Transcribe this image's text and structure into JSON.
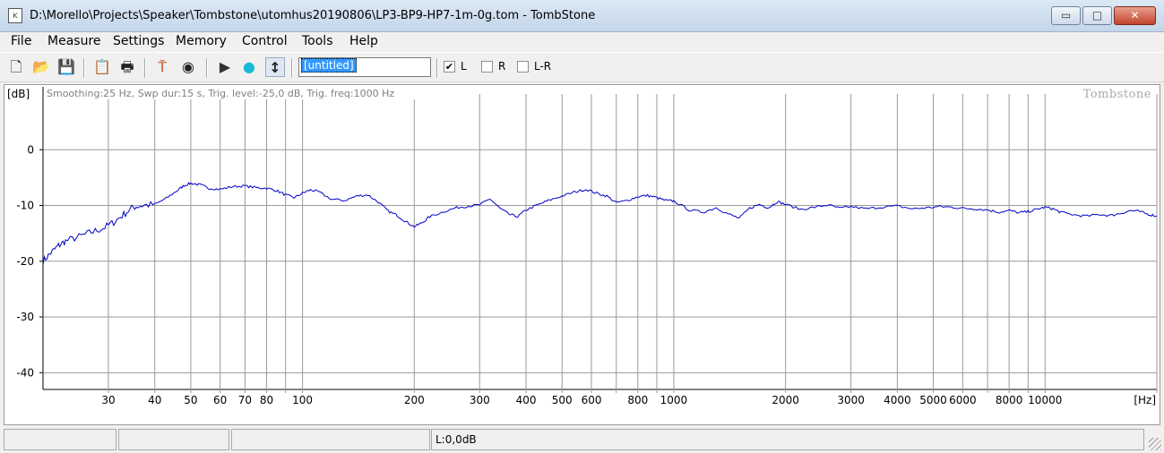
{
  "window": {
    "title": "D:\\Morello\\Projects\\Speaker\\Tombstone\\utomhus20190806\\LP3-BP9-HP7-1m-0g.tom - TombStone",
    "app_icon": "tombstone-app-icon",
    "minimize_glyph": "▭",
    "maximize_glyph": "□",
    "close_glyph": "✕"
  },
  "menu": {
    "items": [
      "File",
      "Measure",
      "Settings",
      "Memory",
      "Control",
      "Tools",
      "Help"
    ]
  },
  "toolbar": {
    "icons": [
      "new-icon",
      "open-icon",
      "save-icon",
      "copy-icon",
      "print-icon",
      "probe-icon",
      "speaker-icon",
      "play-icon",
      "monitor-icon",
      "cursor-icon"
    ],
    "glyphs": [
      "🗋",
      "📂",
      "💾",
      "📋",
      "🖶",
      "⍑",
      "◉",
      "▶",
      "●",
      "↕"
    ],
    "name_field_value": "[untitled]",
    "checkboxes": [
      {
        "label": "L",
        "checked": true
      },
      {
        "label": "R",
        "checked": false
      },
      {
        "label": "L-R",
        "checked": false
      }
    ]
  },
  "chart_data": {
    "type": "line",
    "y_unit_label": "[dB]",
    "x_unit_label": "[Hz]",
    "info_text": "Smoothing:25 Hz, Swp dur:15 s, Trig. level:-25,0 dB, Trig. freq:1000 Hz",
    "watermark": "Tombstone",
    "x_scale": "log",
    "xlim": [
      20,
      20000
    ],
    "ylim": [
      -43,
      10
    ],
    "y_ticks": [
      0,
      -10,
      -20,
      -30,
      -40
    ],
    "x_tick_labels": [
      "30",
      "40",
      "50",
      "60",
      "70",
      "80",
      "100",
      "200",
      "300",
      "400",
      "500",
      "600",
      "800",
      "1000",
      "2000",
      "3000",
      "4000",
      "5000",
      "6000",
      "8000",
      "10000"
    ],
    "x_tick_values": [
      30,
      40,
      50,
      60,
      70,
      80,
      100,
      200,
      300,
      400,
      500,
      600,
      800,
      1000,
      2000,
      3000,
      4000,
      5000,
      6000,
      8000,
      10000
    ],
    "x_minor_ticks": [
      90,
      700,
      900,
      7000,
      9000,
      20000
    ],
    "grid": true,
    "line_color": "#0000c8",
    "series": [
      {
        "x": [
          20,
          21,
          22,
          23,
          25,
          27,
          29,
          31,
          33,
          35,
          37,
          40,
          43,
          46,
          48,
          50,
          53,
          56,
          60,
          65,
          70,
          75,
          80,
          85,
          90,
          95,
          100,
          105,
          110,
          120,
          130,
          140,
          150,
          160,
          170,
          180,
          190,
          200,
          210,
          220,
          240,
          260,
          280,
          300,
          320,
          340,
          360,
          380,
          400,
          430,
          460,
          500,
          540,
          580,
          620,
          660,
          700,
          750,
          800,
          850,
          900,
          950,
          1000,
          1100,
          1200,
          1300,
          1400,
          1500,
          1600,
          1700,
          1800,
          1900,
          2000,
          2200,
          2400,
          2600,
          2800,
          3000,
          3300,
          3600,
          4000,
          4400,
          4800,
          5200,
          5600,
          6000,
          6500,
          7000,
          7500,
          8000,
          8500,
          9000,
          9500,
          10000,
          10500,
          11000,
          12000,
          13000,
          14000,
          15000,
          16000,
          17000,
          18000,
          19000,
          20000
        ],
        "y": [
          -20,
          -18.5,
          -17.2,
          -16.4,
          -15.6,
          -14.8,
          -14.1,
          -13,
          -11.6,
          -10.3,
          -10,
          -9.8,
          -8.7,
          -7.3,
          -6.4,
          -6,
          -6.3,
          -6.9,
          -7.1,
          -6.6,
          -6.5,
          -6.8,
          -6.9,
          -7.3,
          -8.1,
          -8.6,
          -7.8,
          -7.2,
          -7.5,
          -8.9,
          -9.1,
          -8.3,
          -8.1,
          -9.4,
          -11,
          -11.8,
          -12.9,
          -13.8,
          -13.1,
          -12,
          -11.1,
          -10.4,
          -10.1,
          -9.9,
          -8.8,
          -10.5,
          -11.6,
          -12,
          -10.8,
          -9.9,
          -9.1,
          -8.3,
          -7.6,
          -7.1,
          -7.8,
          -8.3,
          -9.5,
          -9.1,
          -8.4,
          -8.2,
          -8.6,
          -9.1,
          -9.2,
          -10.8,
          -11.2,
          -10.4,
          -11.5,
          -12.3,
          -10.5,
          -9.8,
          -10.4,
          -9.3,
          -9.8,
          -10.7,
          -10.3,
          -9.9,
          -10.5,
          -10.2,
          -10.6,
          -10.3,
          -10.1,
          -10.6,
          -10.4,
          -10.2,
          -10.3,
          -10.5,
          -10.6,
          -10.8,
          -11.2,
          -10.9,
          -11.3,
          -11.1,
          -10.7,
          -10.3,
          -10.6,
          -11.2,
          -11.7,
          -11.9,
          -11.6,
          -11.8,
          -11.4,
          -10.9,
          -11.1,
          -11.6,
          -11.9
        ]
      }
    ]
  },
  "status": {
    "panels": [
      "",
      "",
      "",
      "L:0,0dB"
    ]
  }
}
